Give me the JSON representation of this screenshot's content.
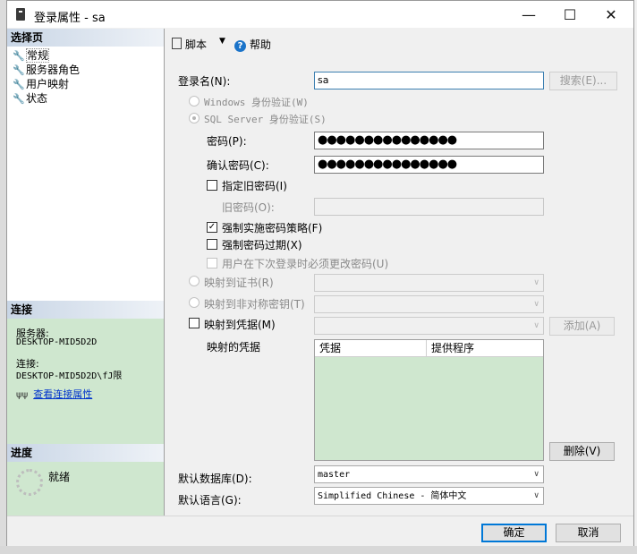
{
  "window": {
    "title": "登录属性 - sa",
    "minimize": "—",
    "maximize": "☐",
    "close": "✕"
  },
  "left": {
    "select_header": "选择页",
    "pages": [
      "常规",
      "服务器角色",
      "用户映射",
      "状态"
    ],
    "conn_header": "连接",
    "server_label": "服务器:",
    "server_value": "DESKTOP-MID5D2D",
    "connection_label": "连接:",
    "connection_value": "DESKTOP-MID5D2D\\fJ限",
    "view_conn_link": "查看连接属性",
    "progress_header": "进度",
    "progress_status": "就绪"
  },
  "toolbar": {
    "script": "脚本",
    "help": "帮助"
  },
  "form": {
    "login_name_label": "登录名(N):",
    "login_name_value": "sa",
    "search_button": "搜索(E)...",
    "windows_auth": "Windows 身份验证(W)",
    "sql_auth": "SQL Server 身份验证(S)",
    "password_label": "密码(P):",
    "password_value": "●●●●●●●●●●●●●●●",
    "confirm_label": "确认密码(C):",
    "confirm_value": "●●●●●●●●●●●●●●●",
    "specify_old": "指定旧密码(I)",
    "old_password_label": "旧密码(O):",
    "enforce_policy": "强制实施密码策略(F)",
    "enforce_expiration": "强制密码过期(X)",
    "must_change": "用户在下次登录时必须更改密码(U)",
    "map_cert": "映射到证书(R)",
    "map_asym": "映射到非对称密钥(T)",
    "map_cred": "映射到凭据(M)",
    "add_button": "添加(A)",
    "mapped_creds_label": "映射的凭据",
    "grid_cols": [
      "凭据",
      "提供程序"
    ],
    "remove_button": "删除(V)",
    "default_db_label": "默认数据库(D):",
    "default_db_value": "master",
    "default_lang_label": "默认语言(G):",
    "default_lang_value": "Simplified Chinese - 简体中文"
  },
  "footer": {
    "ok": "确定",
    "cancel": "取消"
  }
}
